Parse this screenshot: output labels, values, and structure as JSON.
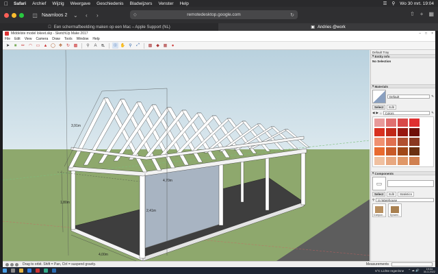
{
  "mac_menubar": {
    "app": "Safari",
    "items": [
      "Archief",
      "Wijzig",
      "Weergave",
      "Geschiedenis",
      "Bladwijzers",
      "Venster",
      "Help"
    ],
    "datetime": "Wo 30 mrt. 19:04"
  },
  "safari": {
    "tab_group": "Naamloos 2",
    "url": "remotedesktop.google.com",
    "tabs": [
      {
        "label": "Een schermafbeelding maken op een Mac – Apple Support (NL)",
        "active": false
      },
      {
        "label": "Andries @work",
        "active": true
      }
    ]
  },
  "sketchup": {
    "title": "Middelste model lokeet.skp - SketchUp Make 2017",
    "menus": [
      "File",
      "Edit",
      "View",
      "Camera",
      "Draw",
      "Tools",
      "Window",
      "Help"
    ],
    "dimensions": [
      "3,91m",
      "4,70m",
      "1,80m",
      "2,41m",
      "4,00m"
    ],
    "status_hint": "Drag to orbit. Shift = Pan, Ctrl = suspend gravity.",
    "measurements_label": "Measurements",
    "tray": {
      "title": "Default Tray",
      "entity_info_header": "Entity Info",
      "entity_info_value": "No Selection",
      "materials_header": "Materials",
      "material_name": "Default",
      "materials_tabs": [
        "Select",
        "Edit"
      ],
      "materials_collection": "Colors",
      "swatches": [
        "#e89a9a",
        "#e07070",
        "#d84848",
        "#e03030",
        "#d83020",
        "#c02818",
        "#981810",
        "#701008",
        "#f09070",
        "#e07050",
        "#b05030",
        "#8a3820",
        "#e86a30",
        "#c85a28",
        "#a04818",
        "#6a3010",
        "#f0c0a0",
        "#e8a880",
        "#e09868",
        "#d08050"
      ],
      "components_header": "Components",
      "components_tabs": [
        "Select",
        "Edit",
        "Statistics"
      ],
      "components_collection": "In Warehouse",
      "components": [
        "Compon...",
        "Dynami..."
      ]
    }
  },
  "taskbar": {
    "weather": "5°C Lichte regen/sne",
    "time": "19:04",
    "date": "30-3-2022"
  }
}
